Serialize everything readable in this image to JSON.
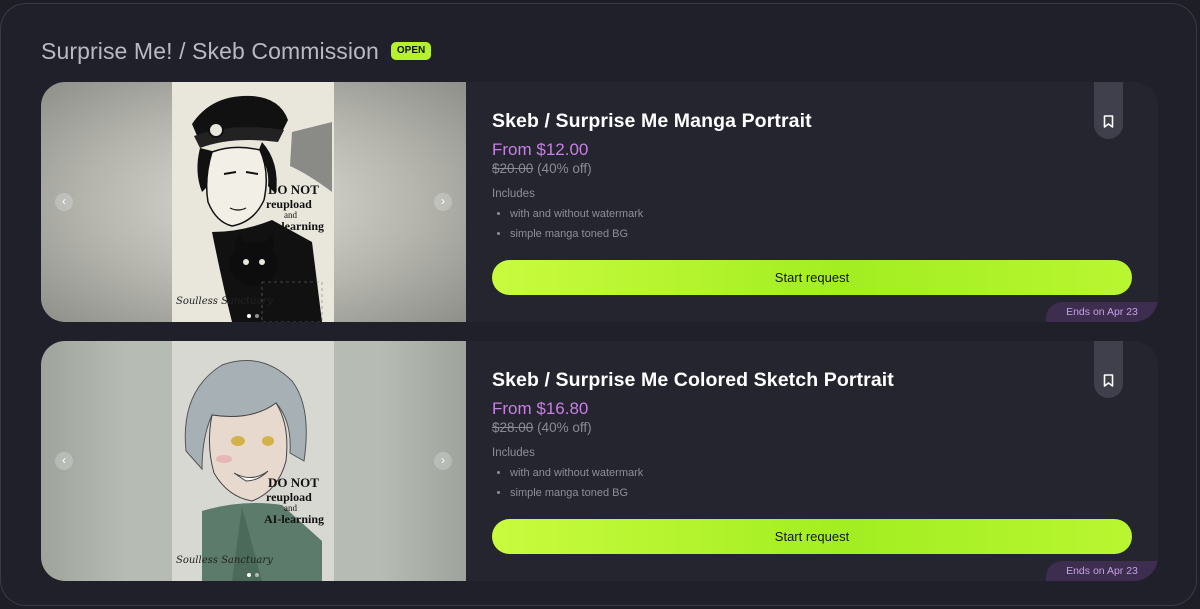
{
  "header": {
    "title": "Surprise Me! / Skeb Commission",
    "status_badge": "OPEN"
  },
  "colors": {
    "accent": "#b5f22a",
    "price": "#c77fe4",
    "ends_text": "#c4a1e6",
    "background": "#20202a"
  },
  "cards": [
    {
      "title": "Skeb / Surprise Me Manga Portrait",
      "price": "From $12.00",
      "original_price": "$20.00",
      "discount": "(40% off)",
      "includes_label": "Includes",
      "includes": [
        "with and without watermark",
        "simple manga toned BG"
      ],
      "button": "Start request",
      "ends": "Ends on Apr 23",
      "image": {
        "watermark_line1": "DO NOT",
        "watermark_line2": "reupload",
        "watermark_line3": "and",
        "watermark_line4": "AI-learning",
        "signature": "Soulless Sanctuary"
      },
      "carousel": {
        "slides": 2,
        "current": 1
      },
      "icons": {
        "prev": "chevron-left-icon",
        "next": "chevron-right-icon",
        "bookmark": "bookmark-icon"
      }
    },
    {
      "title": "Skeb / Surprise Me Colored Sketch Portrait",
      "price": "From $16.80",
      "original_price": "$28.00",
      "discount": "(40% off)",
      "includes_label": "Includes",
      "includes": [
        "with and without watermark",
        "simple manga toned BG"
      ],
      "button": "Start request",
      "ends": "Ends on Apr 23",
      "image": {
        "watermark_line1": "DO NOT",
        "watermark_line2": "reupload",
        "watermark_line3": "and",
        "watermark_line4": "AI-learning",
        "signature": "Soulless Sanctuary"
      },
      "carousel": {
        "slides": 2,
        "current": 1
      },
      "icons": {
        "prev": "chevron-left-icon",
        "next": "chevron-right-icon",
        "bookmark": "bookmark-icon"
      }
    }
  ]
}
